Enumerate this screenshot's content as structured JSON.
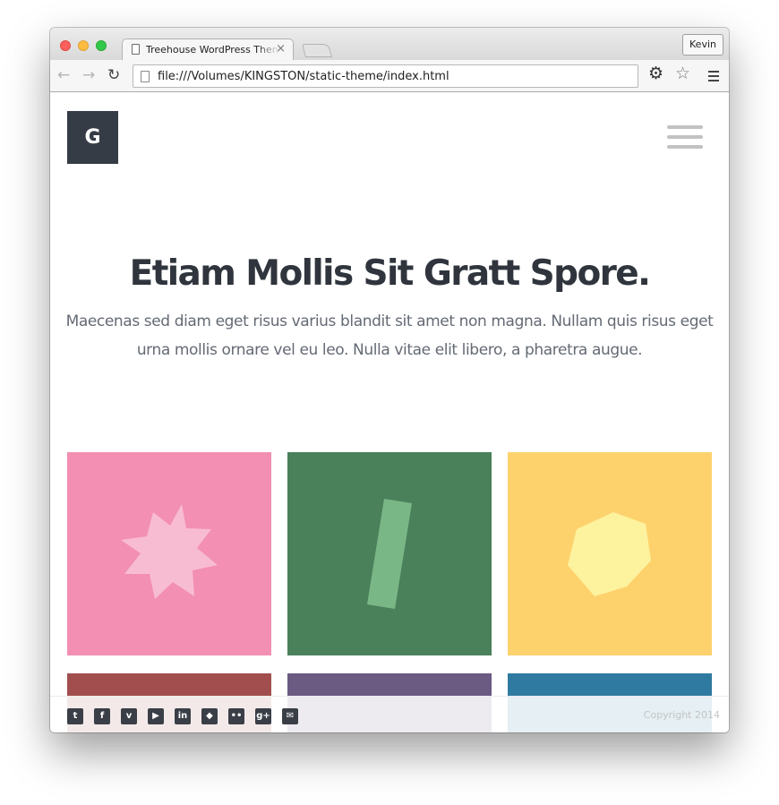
{
  "browser": {
    "tab_title": "Treehouse WordPress Theme",
    "tab_close": "×",
    "profile_name": "Kevin",
    "url": "file:///Volumes/KINGSTON/static-theme/index.html",
    "icons": {
      "back": "back-arrow-icon",
      "forward": "forward-arrow-icon",
      "reload": "reload-icon",
      "settings": "gear-icon",
      "bookmark": "star-icon",
      "menu": "menu-icon"
    },
    "back_glyph": "←",
    "forward_glyph": "→",
    "reload_glyph": "↻",
    "gear_glyph": "⚙",
    "star_glyph": "☆"
  },
  "site": {
    "logo_letter": "G",
    "hero_title": "Etiam Mollis Sit Gratt Spore.",
    "hero_text": "Maecenas sed diam eget risus varius blandit sit amet non magna. Nullam quis risus eget urna mollis ornare vel eu leo. Nulla vitae elit libero, a pharetra augue.",
    "tiles": [
      {
        "color": "#f28fb2",
        "shape": "star",
        "shape_color": "#f8bcd2"
      },
      {
        "color": "#4a805a",
        "shape": "bar",
        "shape_color": "#7ab787"
      },
      {
        "color": "#fdd26d",
        "shape": "hexagon",
        "shape_color": "#fdf29e"
      },
      {
        "color": "#a24e4e"
      },
      {
        "color": "#6b5a82"
      },
      {
        "color": "#2f7aa0"
      }
    ],
    "social_icons": [
      {
        "name": "twitter-icon",
        "glyph": "t"
      },
      {
        "name": "facebook-icon",
        "glyph": "f"
      },
      {
        "name": "vimeo-icon",
        "glyph": "v"
      },
      {
        "name": "youtube-icon",
        "glyph": "▶"
      },
      {
        "name": "linkedin-icon",
        "glyph": "in"
      },
      {
        "name": "github-icon",
        "glyph": "◆"
      },
      {
        "name": "flickr-icon",
        "glyph": "••"
      },
      {
        "name": "google-plus-icon",
        "glyph": "g+"
      },
      {
        "name": "mail-icon",
        "glyph": "✉"
      }
    ],
    "copyright": "Copyright 2014"
  }
}
